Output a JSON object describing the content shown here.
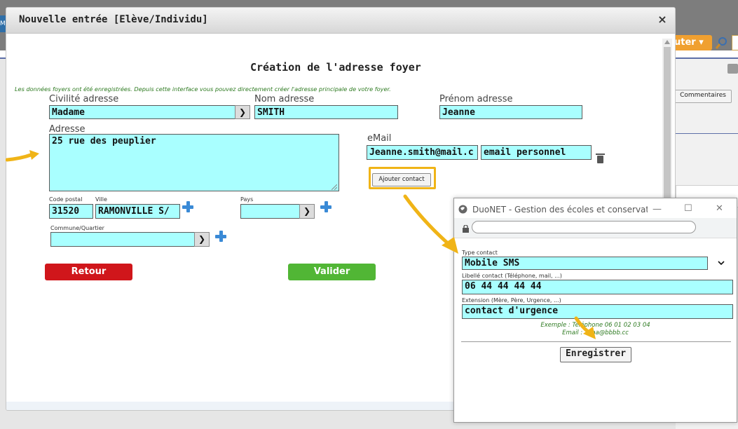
{
  "background": {
    "logo_letter": "M",
    "orange_button_label": "uter",
    "orange_button_caret": "▾",
    "comments_button": "Commentaires"
  },
  "modal": {
    "title": "Nouvelle entrée [Elève/Individu]",
    "close": "×",
    "heading": "Création de l'adresse foyer",
    "note": "Les données foyers ont été enregistrées. Depuis cette interface vous pouvez directement créer l'adresse principale de votre foyer.",
    "form": {
      "civilite_label": "Civilité adresse",
      "civilite_value": "Madame",
      "nom_label": "Nom adresse",
      "nom_value": "SMITH",
      "prenom_label": "Prénom adresse",
      "prenom_value": "Jeanne",
      "adresse_label": "Adresse",
      "adresse_value": "25 rue des peuplier",
      "email_label": "eMail",
      "email_value": "Jeanne.smith@mail.c",
      "email_type": "email personnel",
      "ajouter_contact": "Ajouter contact",
      "cp_label": "Code postal",
      "cp_value": "31520",
      "ville_label": "Ville",
      "ville_value": "RAMONVILLE S/",
      "pays_label": "Pays",
      "pays_value": "",
      "commune_label": "Commune/Quartier",
      "commune_value": ""
    },
    "buttons": {
      "retour": "Retour",
      "valider": "Valider"
    }
  },
  "popup": {
    "title": "DuoNET - Gestion des écoles et conservatoi...",
    "minimize": "—",
    "maximize": "☐",
    "close": "✕",
    "type_label": "Type contact",
    "type_value": "Mobile SMS",
    "libelle_label": "Libellé contact (Téléphone, mail, ...)",
    "libelle_value": "06 44 44 44 44",
    "extension_label": "Extension (Mère, Père, Urgence, ...)",
    "extension_value": "contact d'urgence",
    "example_line1": "Exemple : Téléphone 06 01 02 03 04",
    "example_line2": "Email : aaaa@bbbb.cc",
    "save_button": "Enregistrer"
  },
  "colors": {
    "field_bg": "#a9ffff",
    "retour": "#d0161b",
    "valider": "#51b635",
    "annotation_arrow": "#f0b417",
    "note_green": "#2d7a20"
  }
}
